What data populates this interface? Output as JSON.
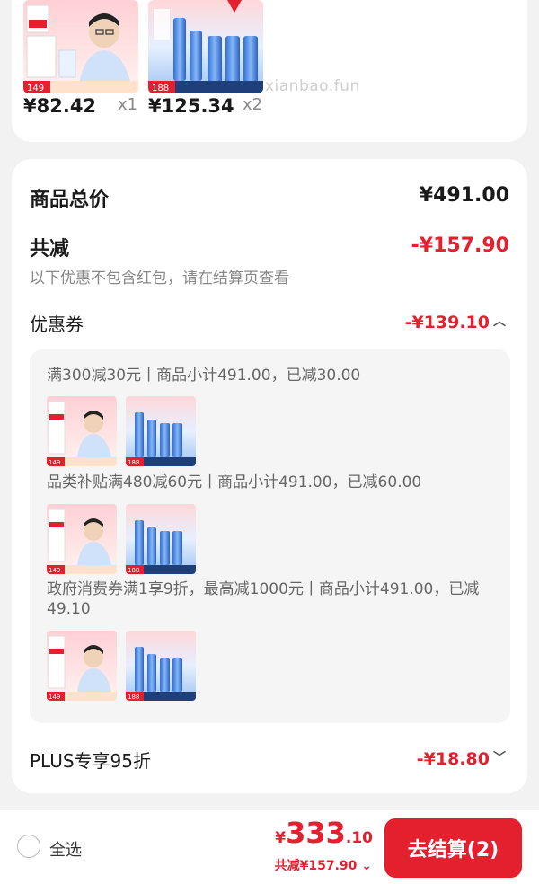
{
  "top_items": [
    {
      "price": "¥82.42",
      "qty": "x1",
      "badge": "149"
    },
    {
      "price": "¥125.34",
      "qty": "x2",
      "badge": "188"
    }
  ],
  "watermark": "xianbao.fun",
  "summary": {
    "goods_total_label": "商品总价",
    "goods_total_value": "¥491.00",
    "total_discount_label": "共减",
    "total_discount_value": "-¥157.90",
    "discount_note": "以下优惠不包含红包，请在结算页查看",
    "coupon_label": "优惠券",
    "coupon_value": "-¥139.10",
    "plus_label": "PLUS专享95折",
    "plus_value": "-¥18.80"
  },
  "coupon_rules": [
    {
      "text": "满300减30元丨商品小计491.00，已减30.00"
    },
    {
      "text": "品类补贴满480减60元丨商品小计491.00，已减60.00"
    },
    {
      "text": "政府消费券满1享9折，最高减1000元丨商品小计491.00，已减49.10"
    }
  ],
  "thumb_badges": [
    "149",
    "188"
  ],
  "bottom": {
    "select_all": "全选",
    "currency": "¥",
    "total_int": "333",
    "total_dec": ".10",
    "saved_text": "共减¥157.90",
    "checkout_label": "去结算(2)"
  },
  "colors": {
    "accent": "#e4202f",
    "card_bg": "#ffffff",
    "page_bg": "#f2f2f2"
  }
}
